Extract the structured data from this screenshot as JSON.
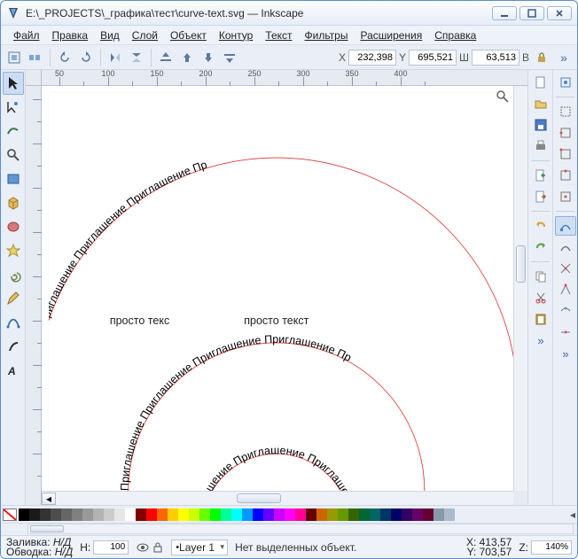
{
  "window": {
    "title": "E:\\_PROJECTS\\_графика\\тест\\curve-text.svg — Inkscape"
  },
  "menu": {
    "file": "Файл",
    "edit": "Правка",
    "view": "Вид",
    "layer": "Слой",
    "object": "Объект",
    "path": "Контур",
    "text": "Текст",
    "filters": "Фильтры",
    "extensions": "Расширения",
    "help": "Справка"
  },
  "coords": {
    "x_label": "X",
    "x_value": "232,398",
    "y_label": "Y",
    "y_value": "695,521",
    "w_label": "Ш",
    "w_value": "63,513",
    "h_label": "В"
  },
  "ruler": {
    "labels": [
      "50",
      "100",
      "150",
      "200",
      "250",
      "300",
      "350",
      "400"
    ]
  },
  "canvas": {
    "curve_text": "Приглашение Приглашение Приглашение Приглашение Пр",
    "plain_text_1": "просто текс",
    "plain_text_2": "просто текст"
  },
  "palette": {
    "colors": [
      "#000000",
      "#1a1a1a",
      "#333333",
      "#4d4d4d",
      "#666666",
      "#808080",
      "#999999",
      "#b3b3b3",
      "#cccccc",
      "#e6e6e6",
      "#ffffff",
      "#800000",
      "#ff0000",
      "#ff6600",
      "#ffcc00",
      "#ffff00",
      "#ccff00",
      "#66ff00",
      "#00ff00",
      "#00ff99",
      "#00ffff",
      "#0099ff",
      "#0000ff",
      "#6600ff",
      "#cc00ff",
      "#ff00ff",
      "#ff0099",
      "#660000",
      "#cc6600",
      "#999900",
      "#669900",
      "#336600",
      "#006633",
      "#006666",
      "#003366",
      "#000066",
      "#330066",
      "#660066",
      "#660033",
      "#8899aa",
      "#aabbcc"
    ]
  },
  "status": {
    "fill_label": "Заливка:",
    "fill_value": "Н/Д",
    "stroke_label": "Обводка:",
    "stroke_value": "Н/Д",
    "h_label": "Н:",
    "h_value": "100",
    "layer": "Layer 1",
    "message": "Нет выделенных объект.",
    "x_label": "X:",
    "x_value": "413,57",
    "y_label": "Y:",
    "y_value": "703,57",
    "z_label": "Z:",
    "z_value": "140%"
  }
}
